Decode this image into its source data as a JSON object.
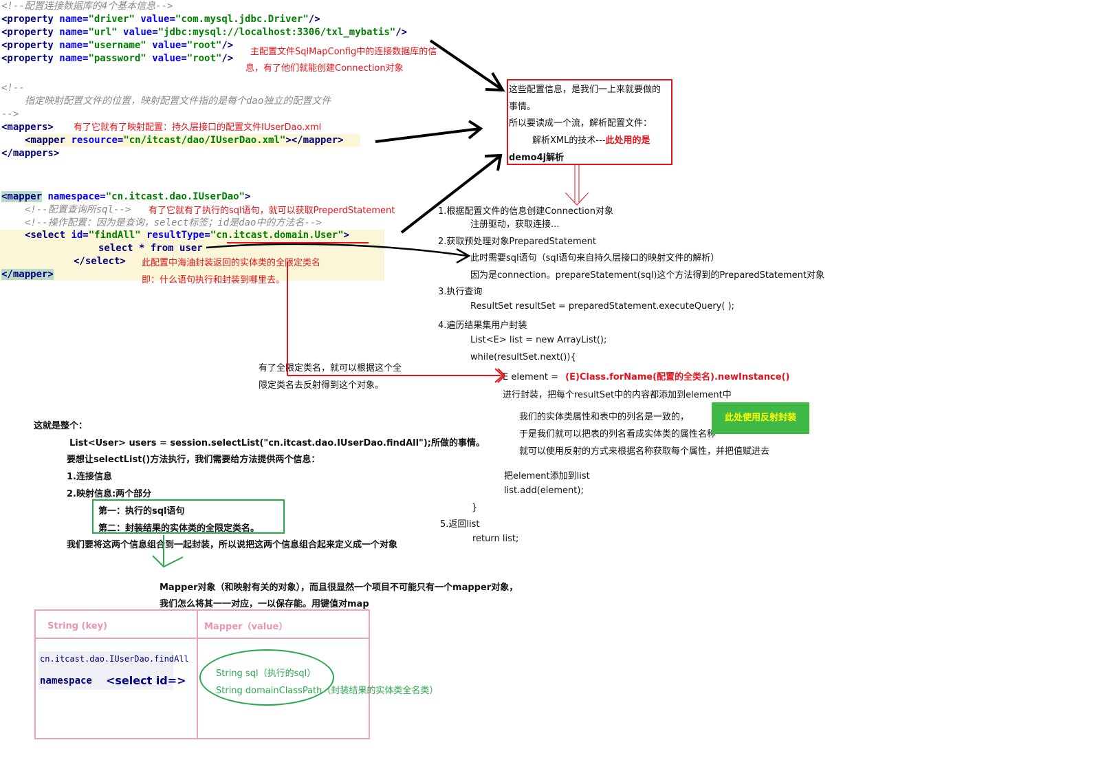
{
  "code_db": {
    "comment": "<!--配置连接数据库的4个基本信息-->",
    "driver": {
      "tag": "<property",
      "name_attr": "name=",
      "name_val": "\"driver\"",
      "value_attr": "value=",
      "value_val": "\"com.mysql.jdbc.Driver\"",
      "end": "/>"
    },
    "url": {
      "tag": "<property",
      "name_attr": "name=",
      "name_val": "\"url\"",
      "value_attr": "value=",
      "value_val": "\"jdbc:mysql://localhost:3306/txl_mybatis\"",
      "end": "/>"
    },
    "username": {
      "tag": "<property",
      "name_attr": "name=",
      "name_val": "\"username\"",
      "value_attr": "value=",
      "value_val": "\"root\"",
      "end": "/>"
    },
    "password": {
      "tag": "<property",
      "name_attr": "name=",
      "name_val": "\"password\"",
      "value_attr": "value=",
      "value_val": "\"root\"",
      "end": "/>"
    }
  },
  "note_db_1": "主配置文件SqlMapConfig中的连接数据库的信",
  "note_db_2": "息，有了他们就能创建Connection对象",
  "code_mappers": {
    "comment_open": "<!--",
    "comment_body": "指定映射配置文件的位置，映射配置文件指的是每个dao独立的配置文件",
    "comment_close": "-->",
    "open": "<mappers>",
    "mapper_tag": "<mapper",
    "resource_attr": "resource=",
    "resource_val": "\"cn/itcast/dao/IUserDao.xml\"",
    "mapper_end": "></mapper>",
    "close": "</mappers>"
  },
  "note_mappers": "有了它就有了映射配置：持久层接口的配置文件IUserDao.xml",
  "code_mapper": {
    "open_tag": "<mapper",
    "ns_attr": "namespace=",
    "ns_val": "\"cn.itcast.dao.IUserDao\"",
    "open_end": ">",
    "comment1": "<!--配置查询所sql-->",
    "comment2": "<!--操作配置：因为是查询，select标签；id是dao中的方法名-->",
    "select_tag": "<select",
    "id_attr": "id=",
    "id_val": "\"findAll\"",
    "rt_attr": "resultType=",
    "rt_val": "\"cn.itcast.domain.User\"",
    "select_end": ">",
    "sql_kw1": "select",
    "sql_rest": "* from user",
    "select_close": "</select>",
    "close": "</mapper>"
  },
  "note_sql": "有了它就有了执行的sql语句，就可以获取PreperdStatement",
  "note_rt_1": "此配置中海油封装返回的实体类的全限定类名",
  "note_rt_2": "即：什么语句执行和封装到哪里去。",
  "box_top": {
    "line1": "这些配置信息，是我们一上来就要做的",
    "line2": "事情。",
    "line3": "所以要读成一个流，解析配置文件：",
    "line4a": "解析XML的技术---",
    "line4b": "此处用的是",
    "line5": "demo4j解析"
  },
  "steps": {
    "s1": "1.根据配置文件的信息创建Connection对象",
    "s1a": "注册驱动，获取连接...",
    "s2": "2.获取预处理对象PreparedStatement",
    "s2a": "此时需要sql语句（sql语句来自持久层接口的映射文件的解析）",
    "s2b": "因为是connection。prepareStatement(sql)这个方法得到的PreparedStatement对象",
    "s3": "3.执行查询",
    "s3a": "ResultSet resultSet = preparedStatement.executeQuery( );",
    "s4": "4.遍历结果集用户封装",
    "s4a": "List<E> list = new ArrayList();",
    "s4b": "while(resultSet.next()){",
    "s4c_a": "E element =",
    "s4c_b": "(E)Class.forName(配置的全类名).newInstance()",
    "s4d": "进行封装，把每个resultSet中的内容都添加到element中",
    "s4e": "我们的实体类属性和表中的列名是一致的，",
    "s4f": "于是我们就可以把表的列名看成实体类的属性名称",
    "s4g": "就可以使用反射的方式来根据名称获取每个属性，并把值赋进去",
    "s4h": "把element添加到list",
    "s4i": "list.add(element);",
    "s4j": "}",
    "s5": "5.返回list",
    "s5a": "return list;"
  },
  "green_badge": "此处使用反射封装",
  "note_reflect_1": "有了全限定类名，就可以根据这个全",
  "note_reflect_2": "限定类名去反射得到这个对象。",
  "summary": {
    "l1": "这就是整个：",
    "l2": "List<User> users = session.selectList(\"cn.itcast.dao.IUserDao.findAll\");所做的事情。",
    "l3": "要想让selectList()方法执行，我们需要给方法提供两个信息：",
    "l4": "1.连接信息",
    "l5": "2.映射信息:两个部分",
    "l6": "第一：执行的sql语句",
    "l7": "第二：封装结果的实体类的全限定类名。",
    "l8": "我们要将这两个信息组合到一起封装，所以说把这两个信息组合起来定义成一个对象"
  },
  "mapper_obj": {
    "l1": "Mapper对象（和映射有关的对象），而且很显然一个项目不可能只有一个mapper对象，",
    "l2": "我们怎么将其一一对应，一以保存能。用键值对map"
  },
  "map_table": {
    "key_header": "String (key)",
    "value_header": "Mapper（value）",
    "key_line1": "cn.itcast.dao.IUserDao.findAll",
    "key_ns": "namespace",
    "key_sel": "<select id=>",
    "val_line1": "String sql（执行的sql）",
    "val_line2": "String domainClassPath（封装结果的实体类全名类）"
  },
  "colors": {
    "red": "#e4131a",
    "green": "#2aa84a",
    "pink": "#e993b6",
    "badge_bg": "#3fb845",
    "badge_text": "#ffff00"
  }
}
